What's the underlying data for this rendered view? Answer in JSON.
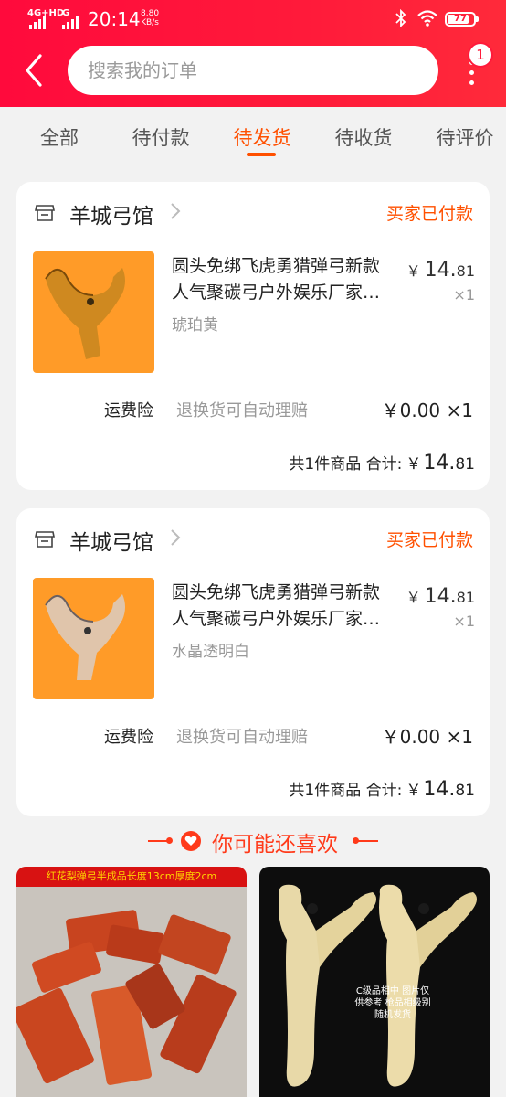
{
  "status_bar": {
    "network": "4G+HD",
    "network2": "G",
    "time": "20:14",
    "speed_value": "8.80",
    "speed_unit": "KB/s",
    "battery": "77"
  },
  "header": {
    "search_placeholder": "搜索我的订单",
    "more_badge": "1"
  },
  "tabs": [
    {
      "label": "全部"
    },
    {
      "label": "待付款"
    },
    {
      "label": "待发货"
    },
    {
      "label": "待收货"
    },
    {
      "label": "待评价"
    }
  ],
  "active_tab": "待发货",
  "orders": [
    {
      "shop": "羊城弓馆",
      "status": "买家已付款",
      "title_line1": "圆头免绑飞虎勇猎弹弓新款",
      "title_line2": "人气聚碳弓户外娱乐厂家…",
      "variant": "琥珀黄",
      "price_symbol": "￥",
      "price_int": "14.",
      "price_dec": "81",
      "qty": "×1",
      "insurance_label": "运费险",
      "insurance_desc": "退换货可自动理赔",
      "insurance_price": "￥0.00 ×1",
      "total_label": "共1件商品 合计:",
      "total_symbol": "￥",
      "total_int": "14.",
      "total_dec": "81"
    },
    {
      "shop": "羊城弓馆",
      "status": "买家已付款",
      "title_line1": "圆头免绑飞虎勇猎弹弓新款",
      "title_line2": "人气聚碳弓户外娱乐厂家…",
      "variant": "水晶透明白",
      "price_symbol": "￥",
      "price_int": "14.",
      "price_dec": "81",
      "qty": "×1",
      "insurance_label": "运费险",
      "insurance_desc": "退换货可自动理赔",
      "insurance_price": "￥0.00 ×1",
      "total_label": "共1件商品 合计:",
      "total_symbol": "￥",
      "total_int": "14.",
      "total_dec": "81"
    }
  ],
  "recommend": {
    "title": "你可能还喜欢",
    "items": [
      {
        "banner": "红花梨弹弓半成品长度13cm厚度2cm"
      },
      {
        "overlay": "C级品相中 图片仅供参考 枪品相级别 随机发货"
      }
    ]
  },
  "colors": {
    "brand_red": "#ff1a3a",
    "accent_orange": "#ff5000"
  }
}
